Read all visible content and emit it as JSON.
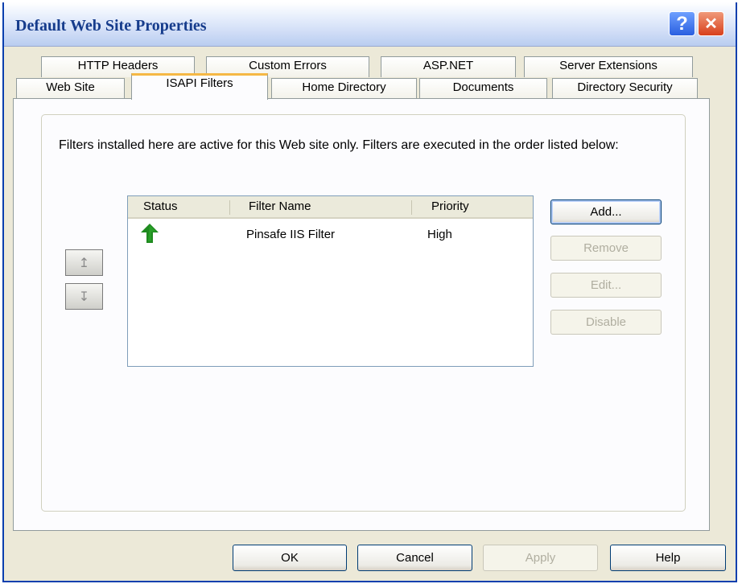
{
  "window": {
    "title": "Default Web Site Properties"
  },
  "titlebar": {
    "help_glyph": "?",
    "close_glyph": "✕"
  },
  "tabs_row1": [
    "HTTP Headers",
    "Custom Errors",
    "ASP.NET",
    "Server Extensions"
  ],
  "tabs_row2": [
    "Web Site",
    "ISAPI Filters",
    "Home Directory",
    "Documents",
    "Directory Security"
  ],
  "active_tab": "ISAPI Filters",
  "description": "Filters installed here are active for this Web site only. Filters are executed in the order listed below:",
  "filter_list": {
    "columns": [
      "Status",
      "Filter Name",
      "Priority"
    ],
    "rows": [
      {
        "status_icon": "green-up-arrow-icon",
        "name": "Pinsafe IIS Filter",
        "priority": "High"
      }
    ]
  },
  "move_buttons": {
    "up_glyph": "↥",
    "down_glyph": "↧"
  },
  "side_buttons": {
    "add": "Add...",
    "remove": "Remove",
    "edit": "Edit...",
    "disable": "Disable"
  },
  "footer_buttons": {
    "ok": "OK",
    "cancel": "Cancel",
    "apply": "Apply",
    "help": "Help"
  },
  "colors": {
    "title_text": "#163c8c",
    "active_tab_accent": "#f5b845",
    "status_arrow": "#1f8a1f",
    "window_border": "#0a3fae"
  }
}
